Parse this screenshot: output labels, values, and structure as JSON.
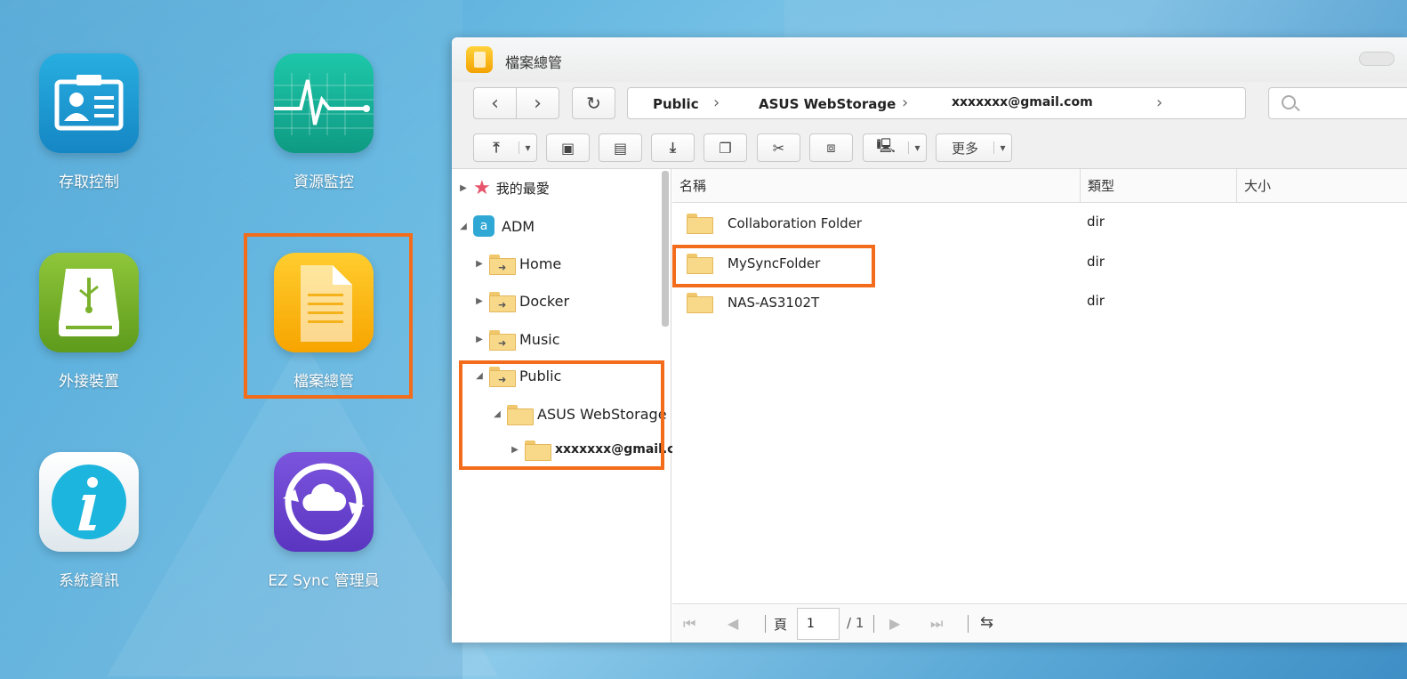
{
  "desktop": {
    "apps": [
      {
        "label": "存取控制",
        "icon": "id-card-icon"
      },
      {
        "label": "資源監控",
        "icon": "heartbeat-monitor-icon"
      },
      {
        "label": "外接裝置",
        "icon": "usb-drive-icon"
      },
      {
        "label": "檔案總管",
        "icon": "file-document-icon"
      },
      {
        "label": "系統資訊",
        "icon": "info-icon"
      },
      {
        "label": "EZ Sync 管理員",
        "icon": "cloud-sync-icon"
      }
    ]
  },
  "window": {
    "title": "檔案總管",
    "breadcrumb": [
      "Public",
      "ASUS WebStorage",
      "xxxxxxx@gmail.com"
    ],
    "search_placeholder": "",
    "toolbar": {
      "more_label": "更多"
    }
  },
  "tree": {
    "favorites": "我的最愛",
    "root": "ADM",
    "folders": [
      "Home",
      "Docker",
      "Music",
      "Public"
    ],
    "public_children": [
      "ASUS WebStorage"
    ],
    "webstorage_children": [
      "xxxxxxx@gmail.c"
    ]
  },
  "list": {
    "columns": {
      "name": "名稱",
      "type": "類型",
      "size": "大小"
    },
    "rows": [
      {
        "name": "Collaboration Folder",
        "type": "dir"
      },
      {
        "name": "MySyncFolder",
        "type": "dir"
      },
      {
        "name": "NAS-AS3102T",
        "type": "dir"
      }
    ]
  },
  "pager": {
    "page_label": "頁",
    "page": "1",
    "total": "/ 1"
  },
  "colors": {
    "highlight": "#f26c1b"
  }
}
